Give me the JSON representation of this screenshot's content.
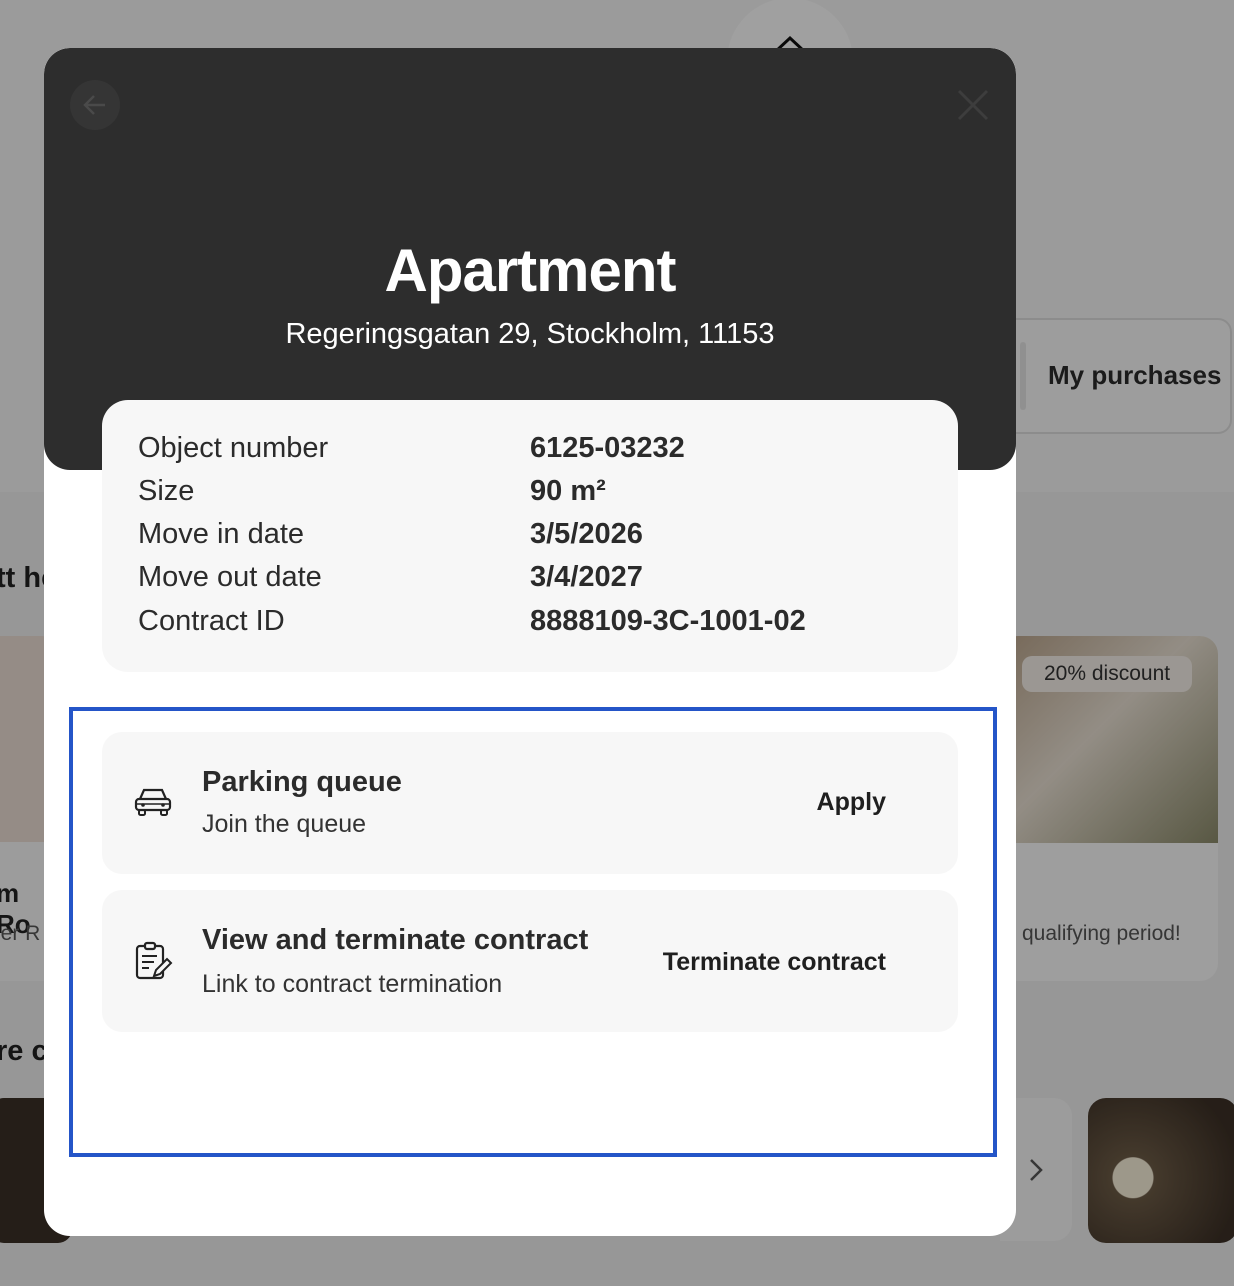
{
  "background": {
    "my_purchases_label": "My purchases",
    "heading_fragment_1": "tt he",
    "heading_fragment_2": "re c",
    "left_card_title_fragment": "m Ro",
    "left_card_sub_fragment": "ler R",
    "right_card_badge": "20% discount",
    "right_card_sub_fragment": "qualifying period!"
  },
  "modal": {
    "title": "Apartment",
    "address": "Regeringsgatan 29, Stockholm, 11153",
    "details": [
      {
        "label": "Object number",
        "value": "6125-03232"
      },
      {
        "label": "Size",
        "value": "90 m²"
      },
      {
        "label": "Move in date",
        "value": "3/5/2026"
      },
      {
        "label": "Move out date",
        "value": "3/4/2027"
      },
      {
        "label": "Contract ID",
        "value": "8888109-3C-1001-02"
      }
    ],
    "actions": [
      {
        "icon": "car-icon",
        "title": "Parking queue",
        "subtitle": "Join the queue",
        "link": "Apply"
      },
      {
        "icon": "contract-edit-icon",
        "title": "View and terminate contract",
        "subtitle": "Link to contract termination",
        "link": "Terminate contract"
      }
    ]
  },
  "colors": {
    "header_bg": "#2d2d2d",
    "card_bg": "#f7f7f7",
    "highlight": "#2455c8"
  }
}
